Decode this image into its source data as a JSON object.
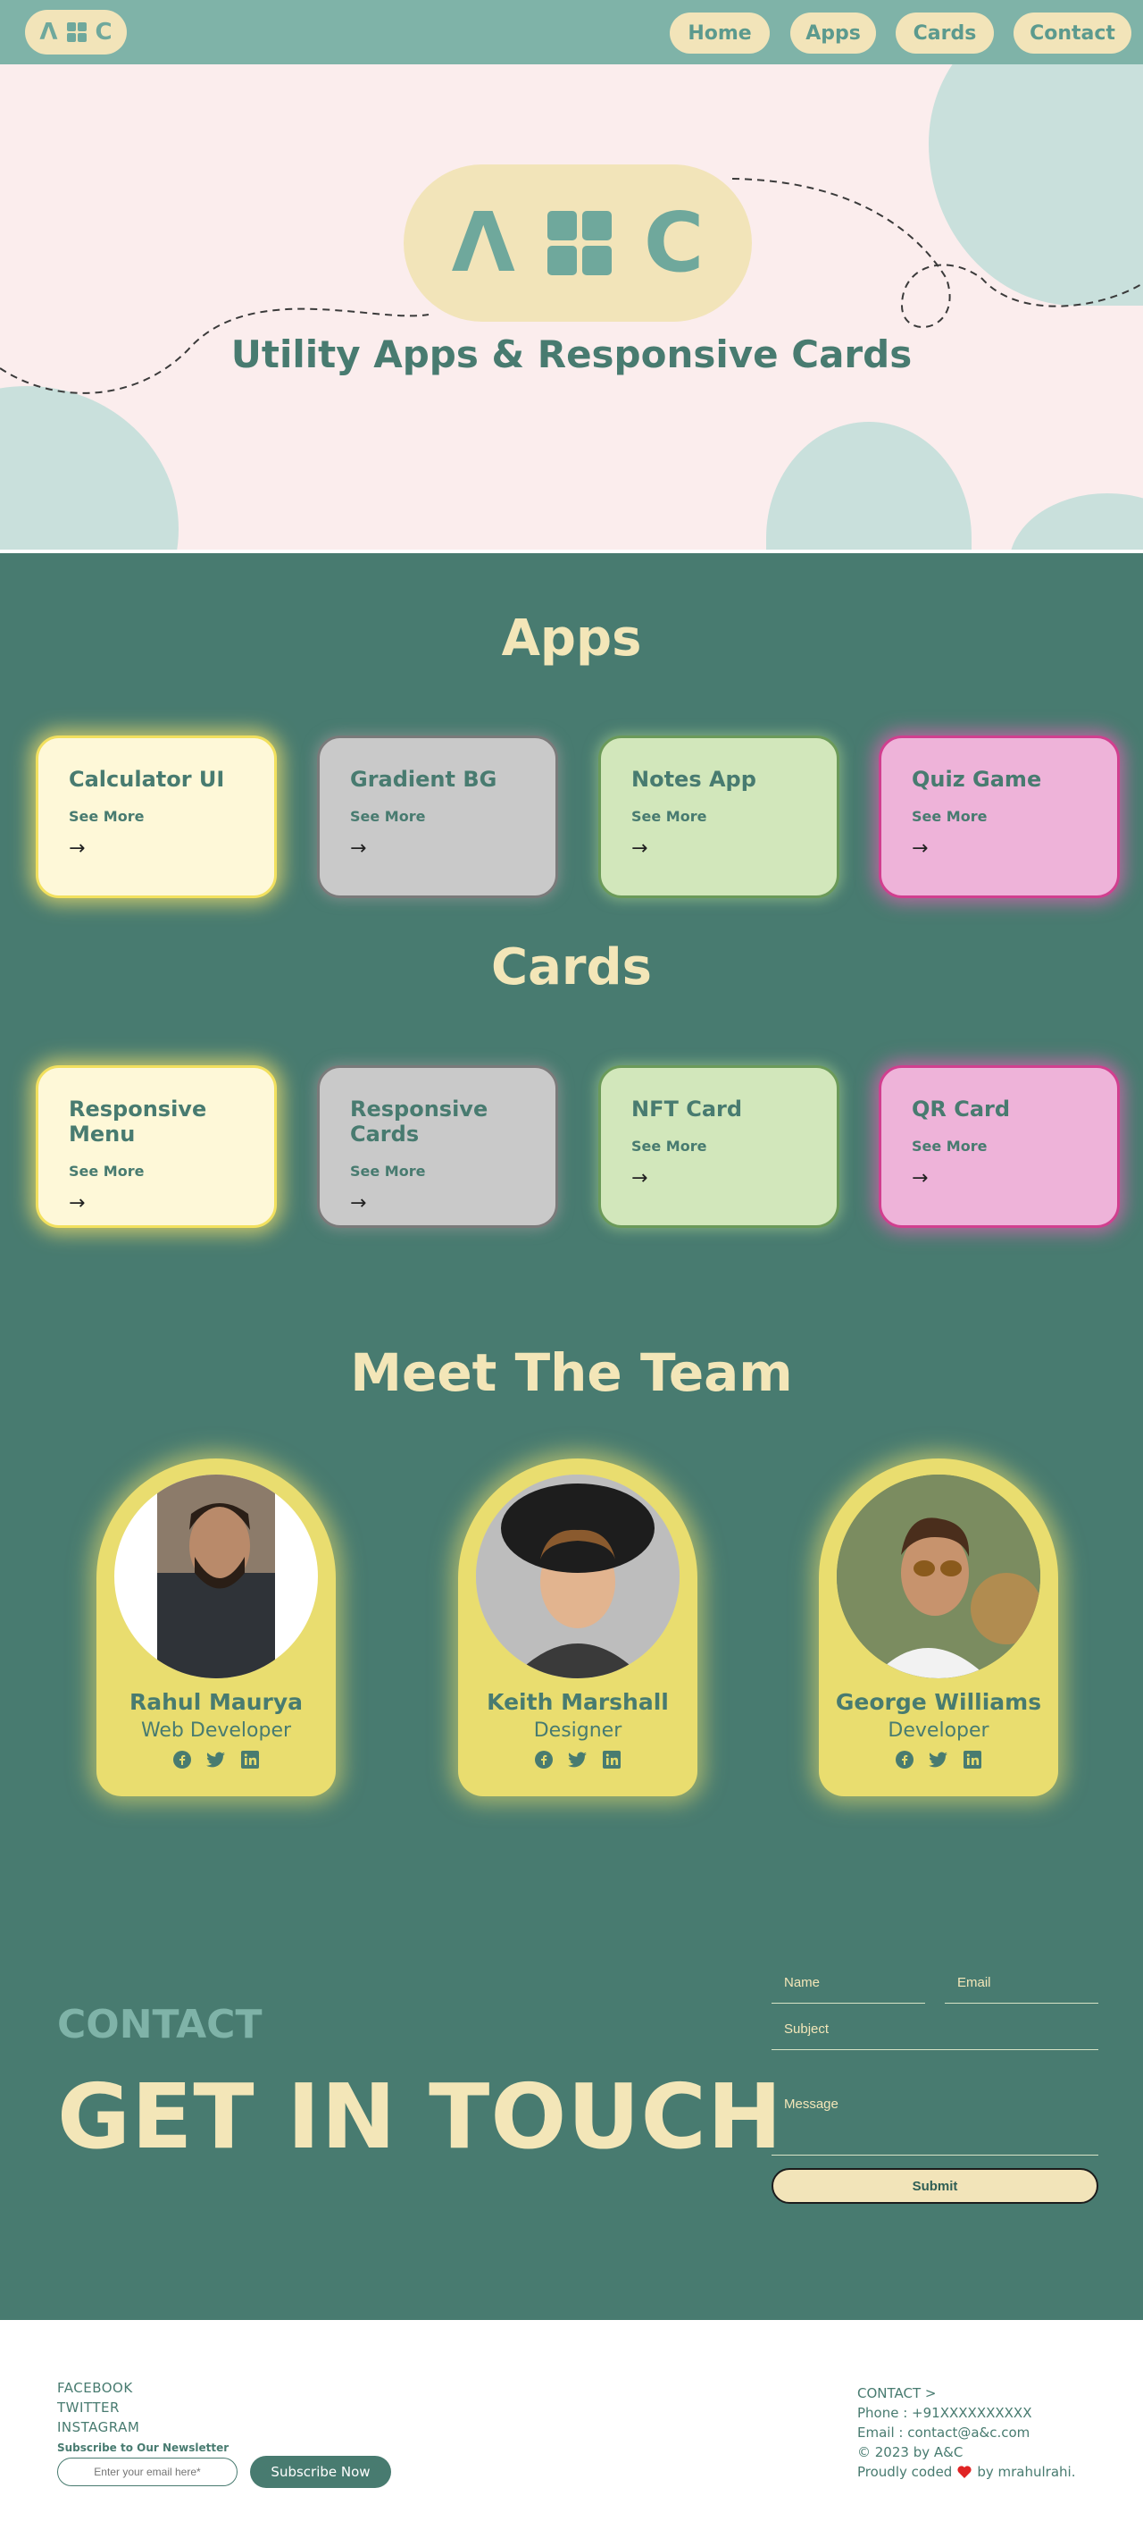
{
  "nav": {
    "logo": [
      "Λ",
      "C"
    ],
    "links": [
      "Home",
      "Apps",
      "Cards",
      "Contact"
    ]
  },
  "hero": {
    "logo": [
      "Λ",
      "C"
    ],
    "title": "Utility Apps & Responsive Cards"
  },
  "apps": {
    "title": "Apps",
    "items": [
      {
        "title": "Calculator UI",
        "link": "See More",
        "arrow": "→"
      },
      {
        "title": "Gradient BG",
        "link": "See More",
        "arrow": "→"
      },
      {
        "title": "Notes App",
        "link": "See More",
        "arrow": "→"
      },
      {
        "title": "Quiz Game",
        "link": "See More",
        "arrow": "→"
      }
    ]
  },
  "cards": {
    "title": "Cards",
    "items": [
      {
        "title": "Responsive Menu",
        "link": "See More",
        "arrow": "→"
      },
      {
        "title": "Responsive Cards",
        "link": "See More",
        "arrow": "→"
      },
      {
        "title": "NFT Card",
        "link": "See More",
        "arrow": "→"
      },
      {
        "title": "QR Card",
        "link": "See More",
        "arrow": "→"
      }
    ]
  },
  "team": {
    "title": "Meet The Team",
    "members": [
      {
        "name": "Rahul Maurya",
        "role": "Web Developer"
      },
      {
        "name": "Keith Marshall",
        "role": "Designer"
      },
      {
        "name": "George Williams",
        "role": "Developer"
      }
    ],
    "social_icons": [
      "facebook-icon",
      "twitter-icon",
      "linkedin-icon"
    ]
  },
  "contact": {
    "label": "CONTACT",
    "headline": "GET IN TOUCH",
    "name_placeholder": "Name",
    "email_placeholder": "Email",
    "subject_placeholder": "Subject",
    "message_placeholder": "Message",
    "submit": "Submit"
  },
  "footer": {
    "links": [
      "FACEBOOK",
      "TWITTER",
      "INSTAGRAM"
    ],
    "newsletter_label": "Subscribe to Our Newsletter",
    "email_placeholder": "Enter your email here*",
    "subscribe_button": "Subscribe Now",
    "contact_title": "CONTACT >",
    "phone": "Phone : +91XXXXXXXXXX",
    "email": "Email : contact@a&c.com",
    "copyright": "© 2023 by A&C",
    "credit_prefix": "Proudly coded",
    "credit_suffix": "by mrahulrahi."
  },
  "colors": {
    "primary": "#487b70",
    "accent": "#f3e6b8",
    "nav": "#7fb3a8",
    "hero_bg": "#fbeded",
    "team_card": "#e9dd6f"
  }
}
